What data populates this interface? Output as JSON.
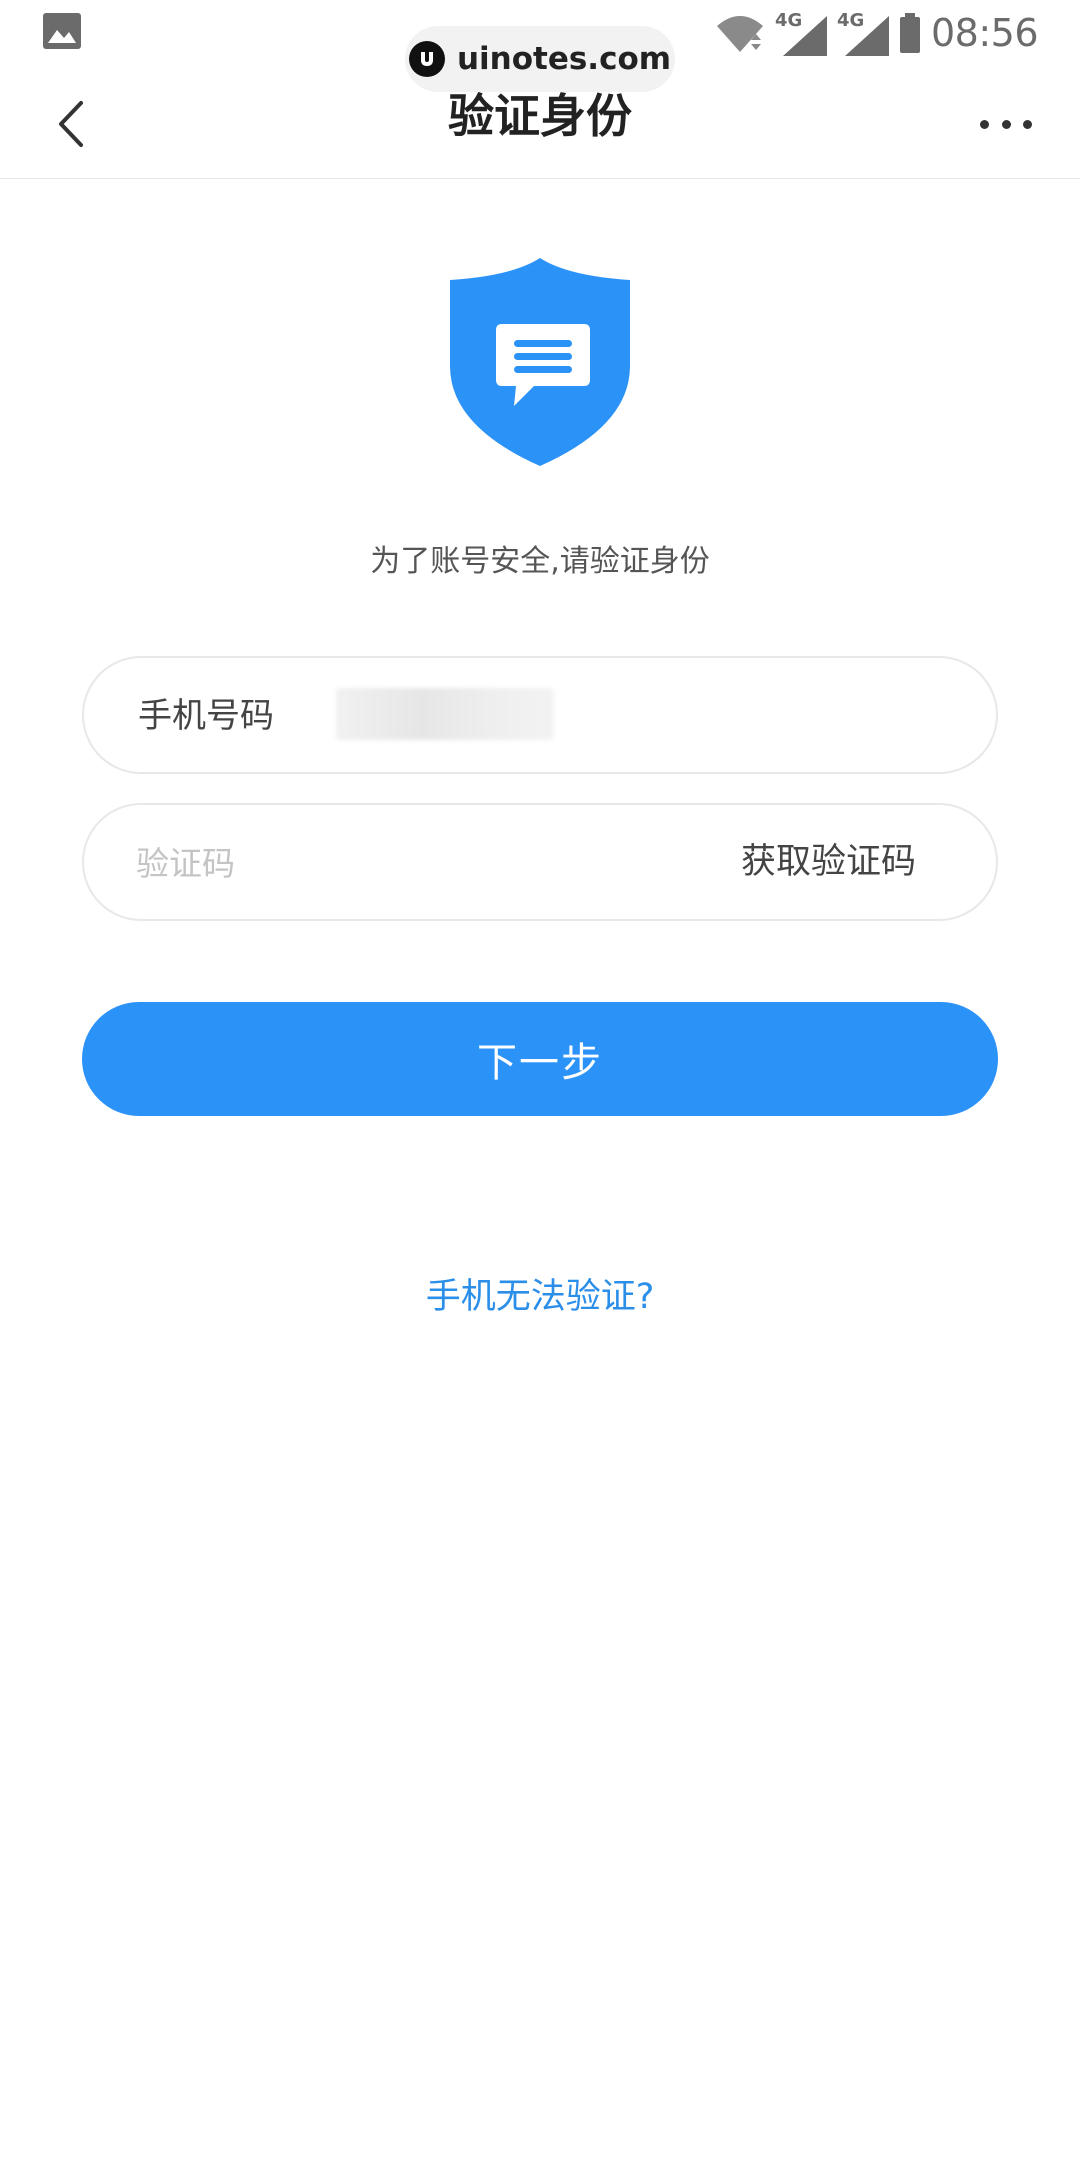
{
  "status_bar": {
    "time": "08:56",
    "network_1": "4G",
    "network_2": "4G",
    "icons": [
      "gallery-icon",
      "wifi-icon",
      "signal-icon",
      "battery-icon"
    ]
  },
  "watermark": {
    "text": "uinotes.com"
  },
  "nav": {
    "title": "验证身份",
    "back_icon": "chevron-left-icon",
    "more_icon": "more-icon"
  },
  "hero": {
    "icon": "shield-message-icon",
    "subtitle": "为了账号安全,请验证身份"
  },
  "form": {
    "phone_label": "手机号码",
    "code_placeholder": "验证码",
    "get_code_label": "获取验证码"
  },
  "actions": {
    "next_label": "下一步",
    "help_link": "手机无法验证?"
  },
  "colors": {
    "primary": "#2b92f8",
    "link": "#2b8ee8",
    "shield": "#2b92f8",
    "border": "#e8e8e8"
  }
}
